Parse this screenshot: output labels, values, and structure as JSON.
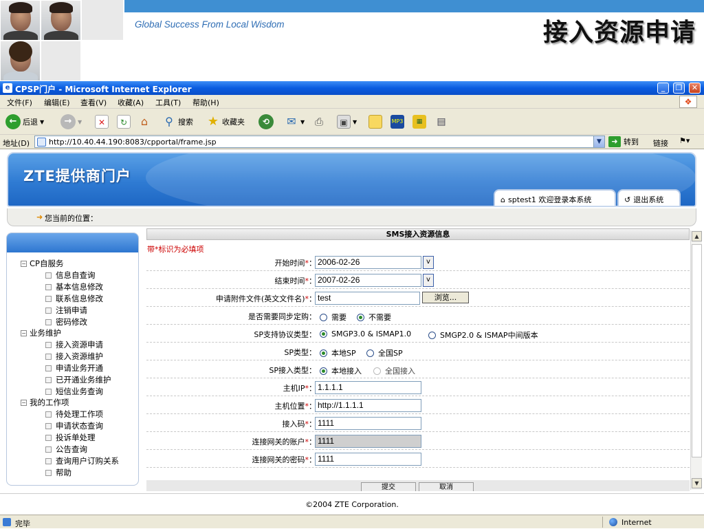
{
  "slide": {
    "tagline": "Global Success From Local Wisdom",
    "title": "接入资源申请"
  },
  "browser": {
    "window_title": "CPSP门户 - Microsoft Internet Explorer",
    "menu": [
      "文件(F)",
      "编辑(E)",
      "查看(V)",
      "收藏(A)",
      "工具(T)",
      "帮助(H)"
    ],
    "toolbar": {
      "back": "后退",
      "search": "搜索",
      "favorites": "收藏夹"
    },
    "address_label": "地址(D)",
    "url": "http://10.40.44.190:8083/cpportal/frame.jsp",
    "go": "转到",
    "links": "链接",
    "status": "完毕",
    "zone": "Internet"
  },
  "portal": {
    "logo": "ZTE提供商门户",
    "user_tab": "sptest1 欢迎登录本系统",
    "logout_tab": "退出系统",
    "location_label": "您当前的位置："
  },
  "sidebar": {
    "groups": [
      {
        "label": "CP自服务",
        "items": [
          "信息自查询",
          "基本信息修改",
          "联系信息修改",
          "注销申请",
          "密码修改"
        ]
      },
      {
        "label": "业务维护",
        "items": [
          "接入资源申请",
          "接入资源维护",
          "申请业务开通",
          "已开通业务维护",
          "短信业务查询"
        ]
      },
      {
        "label": "我的工作项",
        "items": [
          "待处理工作项",
          "申请状态查询",
          "投诉单处理",
          "公告查询",
          "查询用户订购关系",
          "帮助"
        ]
      }
    ]
  },
  "form": {
    "header": "SMS接入资源信息",
    "required_note": "带*标识为必填项",
    "start_time": {
      "label": "开始时间",
      "value": "2006-02-26"
    },
    "end_time": {
      "label": "结束时间",
      "value": "2007-02-26"
    },
    "attachment": {
      "label": "申请附件文件(英文文件名)",
      "value": "test",
      "browse": "浏览..."
    },
    "sync_order": {
      "label": "是否需要同步定购：",
      "options": [
        "需要",
        "不需要"
      ],
      "selected": "不需要"
    },
    "protocol": {
      "label": "SP支持协议类型：",
      "options": [
        "SMGP3.0 & ISMAP1.0",
        "SMGP2.0 & ISMAP中间版本"
      ],
      "selected": "SMGP3.0 & ISMAP1.0"
    },
    "sp_type": {
      "label": "SP类型：",
      "options": [
        "本地SP",
        "全国SP"
      ],
      "selected": "本地SP"
    },
    "access_type": {
      "label": "SP接入类型：",
      "options": [
        "本地接入",
        "全国接入"
      ],
      "selected": "本地接入"
    },
    "host_ip": {
      "label": "主机IP",
      "value": "1.1.1.1"
    },
    "host_location": {
      "label": "主机位置",
      "value": "http://1.1.1.1"
    },
    "access_code": {
      "label": "接入码",
      "value": "1111"
    },
    "gateway_account": {
      "label": "连接网关的账户",
      "value": "1111"
    },
    "gateway_password": {
      "label": "连接网关的密码",
      "value": "1111"
    },
    "submit": "提交",
    "cancel": "取消",
    "calendar_btn": "v"
  },
  "footer": {
    "copyright": "©2004 ZTE Corporation."
  }
}
